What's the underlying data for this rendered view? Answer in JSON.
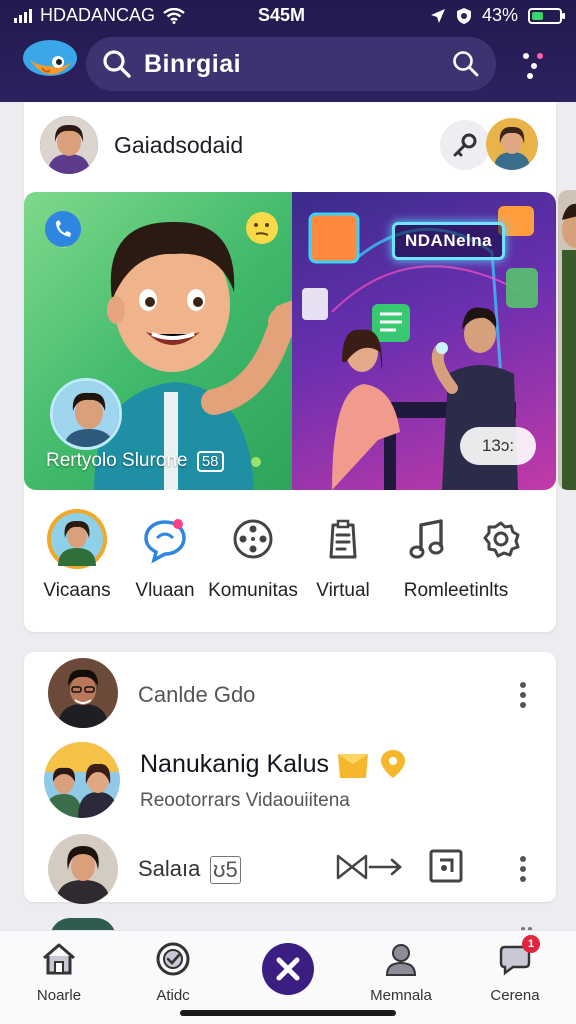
{
  "status_bar": {
    "carrier": "HDADANCAG",
    "time": "S45M",
    "battery": "43%",
    "battery_level": 0.43
  },
  "header": {
    "search_query": "Binrgiai"
  },
  "profile": {
    "username": "Gaiadsodaid"
  },
  "hero": {
    "caption": "Rertyolo Slurone",
    "caption_badge": "58",
    "neon_sign": "NDANelna",
    "pill": "13ɔ:"
  },
  "features": [
    {
      "label": "Vicaans"
    },
    {
      "label": "Vluaan"
    },
    {
      "label": "Komunitas"
    },
    {
      "label": "Virtual"
    },
    {
      "label": "Romleetinlts"
    }
  ],
  "feed": {
    "row1": {
      "title": "Canlde Gdo"
    },
    "row2": {
      "title": "Nanukanig Kalus",
      "subtitle": "Reootorrars Vidaouiitena"
    },
    "row3": {
      "title": "Salaıa",
      "count": "ʊ5"
    }
  },
  "bottom_nav": [
    {
      "label": "Noarle"
    },
    {
      "label": "Atidc"
    },
    {
      "label": ""
    },
    {
      "label": "Memnala"
    },
    {
      "label": "Cerena",
      "badge": "1"
    }
  ],
  "colors": {
    "header_bg": "#221a4d",
    "search_bg": "#3b3470",
    "center_button": "#3c1d82",
    "badge": "#e0263f",
    "accent_blue": "#2f86e0"
  }
}
